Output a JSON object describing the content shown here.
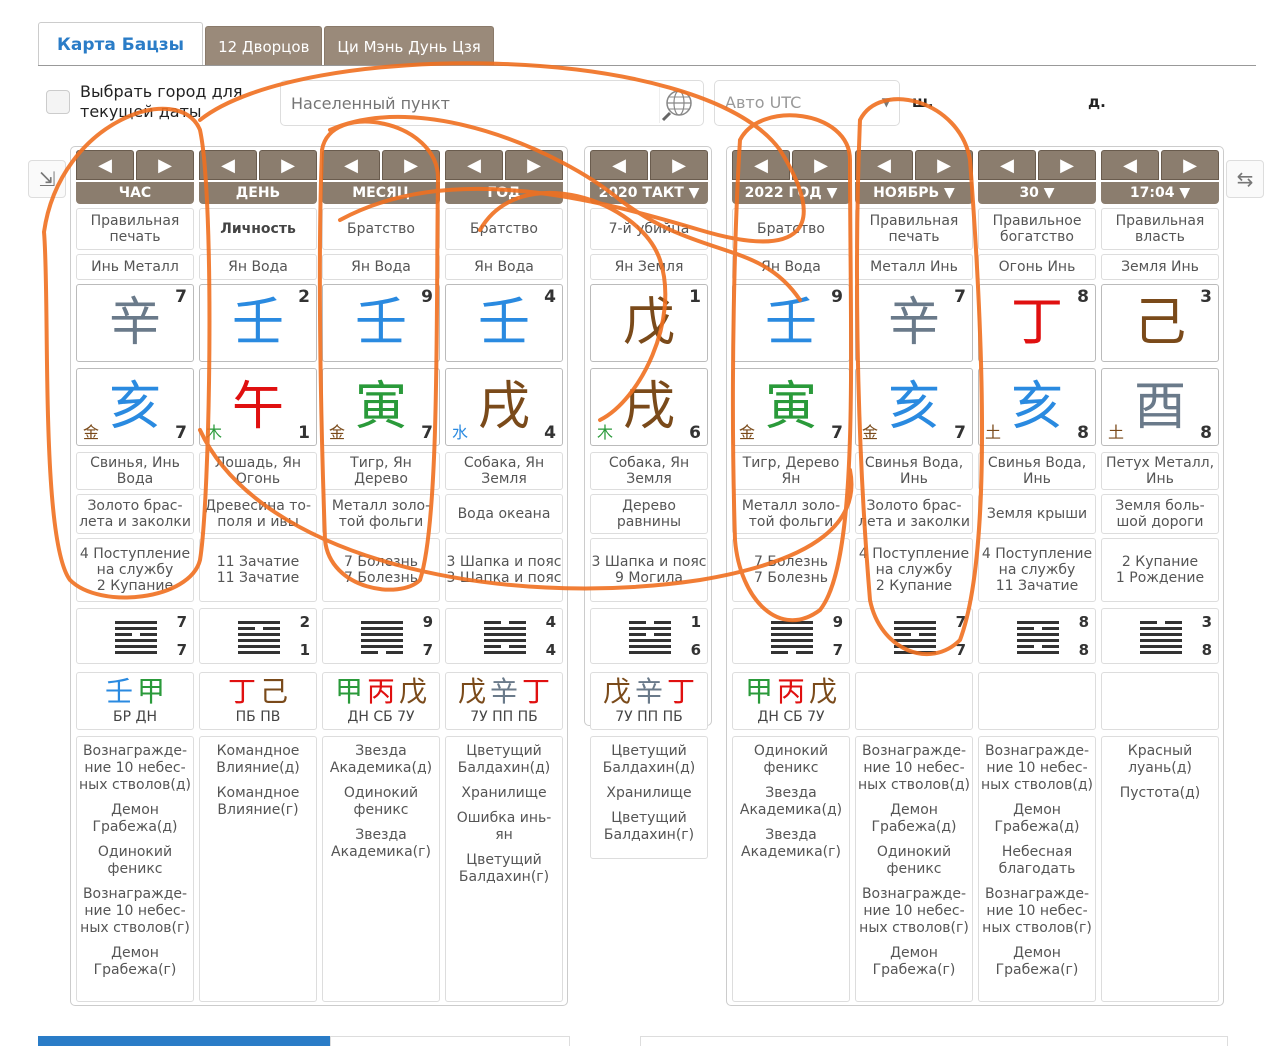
{
  "tabs": [
    "Карта Бацзы",
    "12 Дворцов",
    "Ци Мэнь Дунь Цзя"
  ],
  "toolbar": {
    "checkbox_label": "Выбрать город для текущей даты",
    "city_placeholder": "Населенный пункт",
    "utc_label": "Авто UTC",
    "label_sh": "ш.",
    "label_d": "д."
  },
  "nav": {
    "prev": "◀",
    "next": "▶"
  },
  "left_columns": [
    {
      "header": "ЧАС",
      "god": "Правильная печать",
      "element": "Инь Металл",
      "stem": {
        "char": "辛",
        "color": "gray",
        "num": "7"
      },
      "branch": {
        "char": "亥",
        "color": "blue",
        "num": "7",
        "el": "金",
        "elcolor": "brown"
      },
      "animal": "Свинья, Инь Вода",
      "melody": "Золото брас-лета и заколки",
      "stages": [
        "4 Поступление на службу",
        "2 Купание"
      ],
      "hex": {
        "n1": "7",
        "n2": "7",
        "lines": [
          1,
          1,
          0,
          1,
          1,
          1
        ]
      },
      "hidden": {
        "g": [
          {
            "c": "壬",
            "col": "blue"
          },
          {
            "c": "甲",
            "col": "green"
          }
        ],
        "lbl": "БР ДН"
      },
      "stars": [
        "Вознагражде-ние 10 небес-ных стволов(д)",
        "Демон Грабежа(д)",
        "Одинокий феникс",
        "Вознагражде-ние 10 небес-ных стволов(г)",
        "Демон Грабежа(г)"
      ]
    },
    {
      "header": "ДЕНЬ",
      "god": "Личность",
      "god_bold": true,
      "element": "Ян Вода",
      "stem": {
        "char": "壬",
        "color": "blue",
        "num": "2"
      },
      "branch": {
        "char": "午",
        "color": "red",
        "num": "1",
        "el": "木",
        "elcolor": "green"
      },
      "animal": "Лошадь, Ян Огонь",
      "melody": "Древесина то-поля и ивы",
      "stages": [
        "11 Зачатие",
        "11 Зачатие"
      ],
      "hex": {
        "n1": "2",
        "n2": "1",
        "lines": [
          1,
          0,
          1,
          1,
          1,
          1
        ]
      },
      "hidden": {
        "g": [
          {
            "c": "丁",
            "col": "red"
          },
          {
            "c": "己",
            "col": "brown"
          }
        ],
        "lbl": "ПБ ПВ"
      },
      "stars": [
        "Командное Влияние(д)",
        "Командное Влияние(г)"
      ]
    },
    {
      "header": "МЕСЯЦ",
      "god": "Братство",
      "element": "Ян Вода",
      "stem": {
        "char": "壬",
        "color": "blue",
        "num": "9"
      },
      "branch": {
        "char": "寅",
        "color": "green",
        "num": "7",
        "el": "金",
        "elcolor": "brown"
      },
      "animal": "Тигр, Ян Дерево",
      "melody": "Металл золо-той фольги",
      "stages": [
        "7 Болезнь",
        "7 Болезнь"
      ],
      "hex": {
        "n1": "9",
        "n2": "7",
        "lines": [
          1,
          1,
          1,
          1,
          1,
          0
        ]
      },
      "hidden": {
        "g": [
          {
            "c": "甲",
            "col": "green"
          },
          {
            "c": "丙",
            "col": "red"
          },
          {
            "c": "戊",
            "col": "brown"
          }
        ],
        "lbl": "ДН СБ 7У"
      },
      "stars": [
        "Звезда Академика(д)",
        "Одинокий феникс",
        "Звезда Академика(г)"
      ]
    },
    {
      "header": "ГОД",
      "god": "Братство",
      "element": "Ян Вода",
      "stem": {
        "char": "壬",
        "color": "blue",
        "num": "4"
      },
      "branch": {
        "char": "戌",
        "color": "brown",
        "num": "4",
        "el": "水",
        "elcolor": "blue"
      },
      "animal": "Собака, Ян Земля",
      "melody": "Вода океана",
      "stages": [
        "3 Шапка и пояс",
        "3 Шапка и пояс"
      ],
      "hex": {
        "n1": "4",
        "n2": "4",
        "lines": [
          0,
          1,
          1,
          1,
          0,
          1
        ]
      },
      "hidden": {
        "g": [
          {
            "c": "戊",
            "col": "brown"
          },
          {
            "c": "辛",
            "col": "gray"
          },
          {
            "c": "丁",
            "col": "red"
          }
        ],
        "lbl": "7У ПП ПБ"
      },
      "stars": [
        "Цветущий Балдахин(д)",
        "Хранилище",
        "Ошибка инь-ян",
        "Цветущий Балдахин(г)"
      ]
    }
  ],
  "mid_column": {
    "header": "2020 ТАКТ ▼",
    "god": "7-й убийца",
    "element": "Ян Земля",
    "stem": {
      "char": "戊",
      "color": "brown",
      "num": "1"
    },
    "branch": {
      "char": "戌",
      "color": "brown",
      "num": "6",
      "el": "木",
      "elcolor": "green"
    },
    "animal": "Собака, Ян Земля",
    "melody": "Дерево равнины",
    "stages": [
      "3 Шапка и пояс",
      "9 Могила"
    ],
    "hex": {
      "n1": "1",
      "n2": "6",
      "lines": [
        0,
        1,
        0,
        1,
        1,
        1
      ]
    },
    "hidden": {
      "g": [
        {
          "c": "戊",
          "col": "brown"
        },
        {
          "c": "辛",
          "col": "gray"
        },
        {
          "c": "丁",
          "col": "red"
        }
      ],
      "lbl": "7У ПП ПБ"
    },
    "stars": [
      "Цветущий Балдахин(д)",
      "Хранилище",
      "Цветущий Балдахин(г)"
    ]
  },
  "right_columns": [
    {
      "header": "2022 ГОД ▼",
      "god": "Братство",
      "element": "Ян Вода",
      "stem": {
        "char": "壬",
        "color": "blue",
        "num": "9"
      },
      "branch": {
        "char": "寅",
        "color": "green",
        "num": "7",
        "el": "金",
        "elcolor": "brown"
      },
      "animal": "Тигр, Дерево Ян",
      "melody": "Металл золо-той фольги",
      "stages": [
        "7 Болезнь",
        "7 Болезнь"
      ],
      "hex": {
        "n1": "9",
        "n2": "7",
        "lines": [
          1,
          1,
          1,
          1,
          1,
          0
        ]
      },
      "hidden": {
        "g": [
          {
            "c": "甲",
            "col": "green"
          },
          {
            "c": "丙",
            "col": "red"
          },
          {
            "c": "戊",
            "col": "brown"
          }
        ],
        "lbl": "ДН СБ 7У"
      },
      "stars": [
        "Одинокий феникс",
        "Звезда Академика(д)",
        "Звезда Академика(г)"
      ]
    },
    {
      "header": "НОЯБРЬ ▼",
      "god": "Правильная печать",
      "element": "Металл Инь",
      "stem": {
        "char": "辛",
        "color": "gray",
        "num": "7"
      },
      "branch": {
        "char": "亥",
        "color": "blue",
        "num": "7",
        "el": "金",
        "elcolor": "brown"
      },
      "animal": "Свинья Вода, Инь",
      "melody": "Золото брас-лета и заколки",
      "stages": [
        "4 Поступление на службу",
        "2 Купание"
      ],
      "hex": {
        "n1": "7",
        "n2": "7",
        "lines": [
          1,
          1,
          0,
          1,
          1,
          1
        ]
      },
      "hidden": null,
      "stars": [
        "Вознагражде-ние 10 небес-ных стволов(д)",
        "Демон Грабежа(д)",
        "Одинокий феникс",
        "Вознагражде-ние 10 небес-ных стволов(г)",
        "Демон Грабежа(г)"
      ]
    },
    {
      "header": "30 ▼",
      "god": "Правильное богатство",
      "element": "Огонь Инь",
      "stem": {
        "char": "丁",
        "color": "red",
        "num": "8"
      },
      "branch": {
        "char": "亥",
        "color": "blue",
        "num": "8",
        "el": "土",
        "elcolor": "brown"
      },
      "animal": "Свинья Вода, Инь",
      "melody": "Земля крыши",
      "stages": [
        "4 Поступление на службу",
        "11 Зачатие"
      ],
      "hex": {
        "n1": "8",
        "n2": "8",
        "lines": [
          1,
          0,
          1,
          1,
          0,
          1
        ]
      },
      "hidden": null,
      "stars": [
        "Вознагражде-ние 10 небес-ных стволов(д)",
        "Демон Грабежа(д)",
        "Небесная благодать",
        "Вознагражде-ние 10 небес-ных стволов(г)",
        "Демон Грабежа(г)"
      ]
    },
    {
      "header": "17:04 ▼",
      "god": "Правильная власть",
      "element": "Земля Инь",
      "stem": {
        "char": "己",
        "color": "brown",
        "num": "3"
      },
      "branch": {
        "char": "酉",
        "color": "gray",
        "num": "8",
        "el": "土",
        "elcolor": "brown"
      },
      "animal": "Петух Металл, Инь",
      "melody": "Земля боль-шой дороги",
      "stages": [
        "2 Купание",
        "1 Рождение"
      ],
      "hex": {
        "n1": "3",
        "n2": "8",
        "lines": [
          0,
          1,
          1,
          1,
          1,
          1
        ]
      },
      "hidden": null,
      "stars": [
        "Красный луань(д)",
        "Пустота(д)"
      ]
    }
  ],
  "colors": {
    "blue": "#2a8ae0",
    "green": "#2a9a3a",
    "red": "#e01010",
    "brown": "#7a4a1a",
    "gray": "#6a7a8a",
    "header": "#8b7d6e",
    "annotation": "#f07020"
  }
}
